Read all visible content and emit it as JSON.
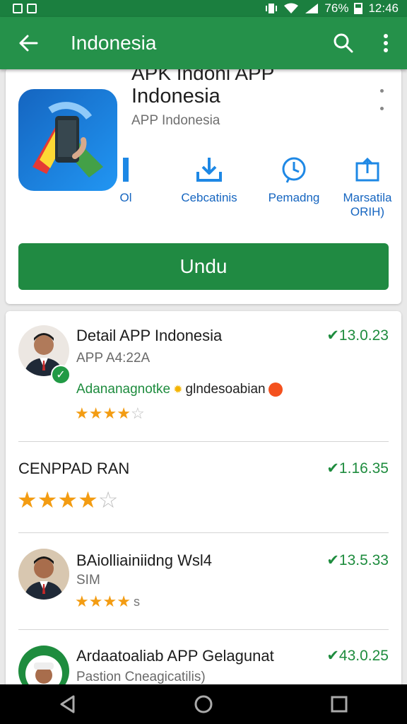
{
  "status_bar": {
    "battery": "76%",
    "time": "12:46"
  },
  "app_bar": {
    "title": "Indonesia"
  },
  "app_card": {
    "clipped_title": "APK Indoni APP",
    "name": "Indonesia",
    "developer": "APP Indonesia",
    "actions": [
      {
        "label": "Ol"
      },
      {
        "label": "Cebcatinis"
      },
      {
        "label": "Pemadng"
      },
      {
        "label": "Marsatila ORIH)"
      }
    ],
    "install_label": "Undu"
  },
  "list": [
    {
      "title": "Detail APP Indonesia",
      "subtitle": "APP A4:22A",
      "version": "✔13.0.23",
      "tag1": "Adananagnotke",
      "tag2": "glndesoabian",
      "rating": 3.5
    },
    {
      "title": "CENPPAD RAN",
      "version": "✔1.16.35",
      "rating": 4
    },
    {
      "title": "BAiolliainiidng Wsl4",
      "subtitle": "SIM",
      "version": "✔13.5.33",
      "rating": 3.5,
      "rating_suffix": "s"
    },
    {
      "title": "Ardaatoaliab APP Gelagunat",
      "subtitle": "Pastion Cneagicatilis)",
      "version": "✔43.0.25"
    }
  ],
  "colors": {
    "primary": "#25914a",
    "status": "#1b7f3f",
    "accent_blue": "#1565c0",
    "star": "#f39c12"
  }
}
